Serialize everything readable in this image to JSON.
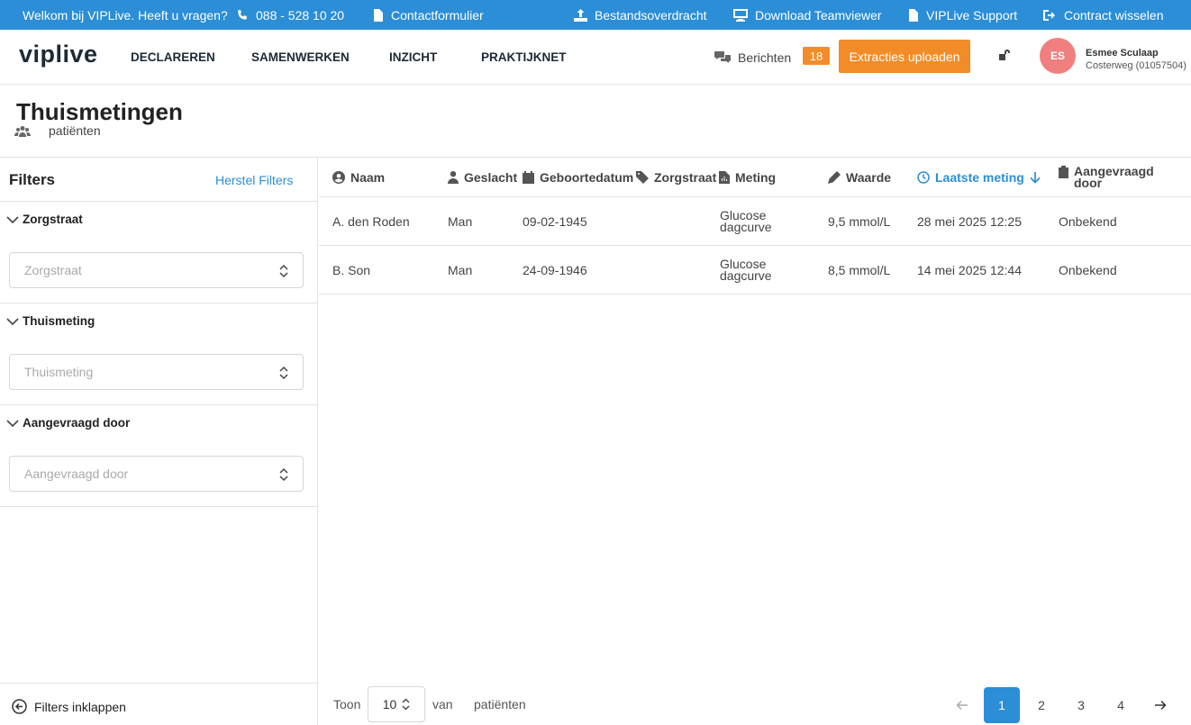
{
  "topbar": {
    "welcome": "Welkom bij VIPLive. Heeft u vragen?",
    "phone": "088 - 528 10 20",
    "contact": "Contactformulier",
    "transfer": "Bestandsoverdracht",
    "teamviewer": "Download Teamviewer",
    "support": "VIPLive Support",
    "switch": "Contract wisselen"
  },
  "header": {
    "logo": "viplive",
    "nav": [
      "DECLAREREN",
      "SAMENWERKEN",
      "INZICHT",
      "PRAKTIJKNET"
    ],
    "messages_label": "Berichten",
    "messages_count": "18",
    "upload_label": "Extracties uploaden",
    "user_initials": "ES",
    "user_name": "Esmee Sculaap",
    "user_location": "Costerweg (01057504)"
  },
  "page": {
    "title": "Thuismetingen",
    "subtitle": "patiënten"
  },
  "sidebar": {
    "title": "Filters",
    "reset": "Herstel Filters",
    "filters": [
      {
        "label": "Zorgstraat",
        "placeholder": "Zorgstraat"
      },
      {
        "label": "Thuismeting",
        "placeholder": "Thuismeting"
      },
      {
        "label": "Aangevraagd door",
        "placeholder": "Aangevraagd door"
      }
    ],
    "collapse": "Filters inklappen"
  },
  "table": {
    "headers": {
      "naam": "Naam",
      "geslacht": "Geslacht",
      "geboortedatum": "Geboortedatum",
      "zorgstraat": "Zorgstraat",
      "meting": "Meting",
      "waarde": "Waarde",
      "laatste": "Laatste meting",
      "aangevraagd_1": "Aangevraagd",
      "aangevraagd_2": "door"
    },
    "rows": [
      {
        "naam": "A. den Roden",
        "geslacht": "Man",
        "geboortedatum": "09-02-1945",
        "meting_1": "Glucose",
        "meting_2": "dagcurve",
        "waarde": "9,5 mmol/L",
        "laatste": "28 mei 2025 12:25",
        "aangevraagd": "Onbekend"
      },
      {
        "naam": "B. Son",
        "geslacht": "Man",
        "geboortedatum": "24-09-1946",
        "meting_1": "Glucose",
        "meting_2": "dagcurve",
        "waarde": "8,5 mmol/L",
        "laatste": "14 mei 2025 12:44",
        "aangevraagd": "Onbekend"
      }
    ]
  },
  "footer": {
    "show": "Toon",
    "per_page": "10",
    "of": "van",
    "unit": "patiënten",
    "pages": [
      "1",
      "2",
      "3",
      "4"
    ],
    "current_page": "1"
  },
  "colors": {
    "primary": "#2b8ed6",
    "accent": "#f28c28",
    "avatar": "#f08080"
  }
}
